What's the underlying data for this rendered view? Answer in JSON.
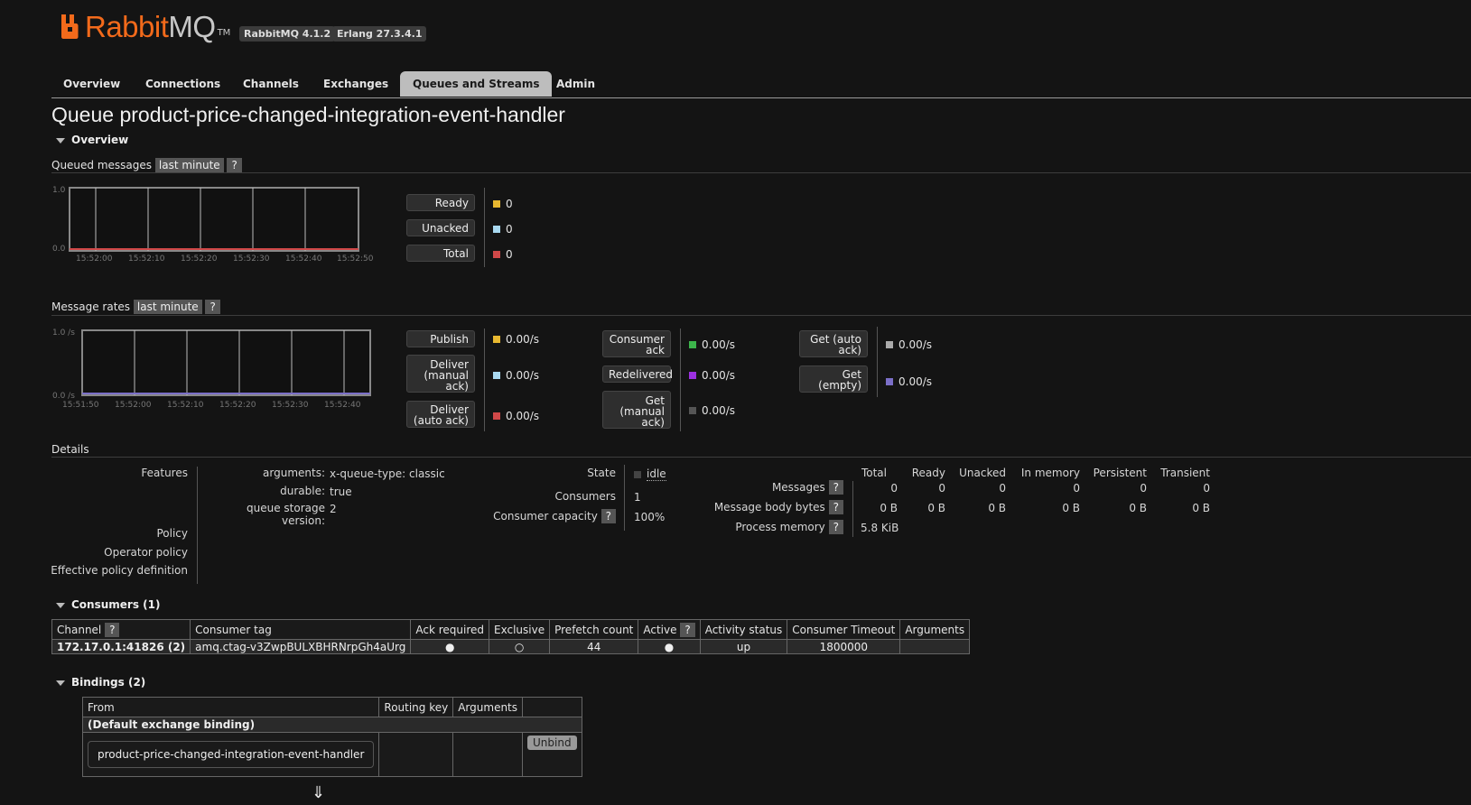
{
  "header": {
    "logo_rabbit": "Rabbit",
    "logo_mq": "MQ",
    "logo_tm": "TM",
    "rabbitmq_version": "RabbitMQ 4.1.2",
    "erlang_version": "Erlang 27.3.4.1"
  },
  "tabs": [
    "Overview",
    "Connections",
    "Channels",
    "Exchanges",
    "Queues and Streams",
    "Admin"
  ],
  "active_tab": "Queues and Streams",
  "page_title": "Queue product-price-changed-integration-event-handler",
  "overview_section": "Overview",
  "queued": {
    "title": "Queued messages",
    "range": "last minute",
    "help": "?",
    "y_top": "1.0",
    "y_bottom": "0.0",
    "x_ticks": [
      "15:52:00",
      "15:52:10",
      "15:52:20",
      "15:52:30",
      "15:52:40",
      "15:52:50"
    ],
    "legend": [
      {
        "label": "Ready",
        "value": "0",
        "color": "#e8b830"
      },
      {
        "label": "Unacked",
        "value": "0",
        "color": "#a8d8f0"
      },
      {
        "label": "Total",
        "value": "0",
        "color": "#d04848"
      }
    ]
  },
  "rates": {
    "title": "Message rates",
    "range": "last minute",
    "help": "?",
    "y_top": "1.0 /s",
    "y_bottom": "0.0 /s",
    "x_ticks": [
      "15:51:50",
      "15:52:00",
      "15:52:10",
      "15:52:20",
      "15:52:30",
      "15:52:40"
    ],
    "col1": [
      {
        "label": "Publish",
        "value": "0.00/s",
        "color": "#e8b830"
      },
      {
        "label": "Deliver (manual ack)",
        "value": "0.00/s",
        "color": "#a8d8f0"
      },
      {
        "label": "Deliver (auto ack)",
        "value": "0.00/s",
        "color": "#d04848"
      }
    ],
    "col2": [
      {
        "label": "Consumer ack",
        "value": "0.00/s",
        "color": "#3cb44b"
      },
      {
        "label": "Redelivered",
        "value": "0.00/s",
        "color": "#9b30e0"
      },
      {
        "label": "Get (manual ack)",
        "value": "0.00/s",
        "color": "#555555"
      }
    ],
    "col3": [
      {
        "label": "Get (auto ack)",
        "value": "0.00/s",
        "color": "#aaaaaa"
      },
      {
        "label": "Get (empty)",
        "value": "0.00/s",
        "color": "#7b6fc8"
      }
    ]
  },
  "details": {
    "title": "Details",
    "features_label": "Features",
    "features": [
      {
        "key": "arguments:",
        "value": "x-queue-type: classic"
      },
      {
        "key": "durable:",
        "value": "true"
      },
      {
        "key": "queue storage version:",
        "value": "2"
      }
    ],
    "policy_label": "Policy",
    "operator_policy_label": "Operator policy",
    "effective_policy_label": "Effective policy definition",
    "state_label": "State",
    "state_value": "idle",
    "consumers_label": "Consumers",
    "consumers_value": "1",
    "capacity_label": "Consumer capacity",
    "capacity_help": "?",
    "capacity_value": "100%",
    "msg_headers": [
      "Total",
      "Ready",
      "Unacked",
      "In memory",
      "Persistent",
      "Transient"
    ],
    "messages_label": "Messages",
    "messages_values": [
      "0",
      "0",
      "0",
      "0",
      "0",
      "0"
    ],
    "body_bytes_label": "Message body bytes",
    "body_bytes_values": [
      "0 B",
      "0 B",
      "0 B",
      "0 B",
      "0 B",
      "0 B"
    ],
    "process_memory_label": "Process memory",
    "process_memory_value": "5.8 KiB",
    "help": "?"
  },
  "consumers": {
    "title": "Consumers (1)",
    "headers": [
      "Channel",
      "Consumer tag",
      "Ack required",
      "Exclusive",
      "Prefetch count",
      "Active",
      "Activity status",
      "Consumer Timeout",
      "Arguments"
    ],
    "help": "?",
    "row": {
      "channel": "172.17.0.1:41826 (2)",
      "tag": "amq.ctag-v3ZwpBULXBHRNrpGh4aUrg",
      "ack_required": "●",
      "exclusive": "○",
      "prefetch": "44",
      "active": "●",
      "activity_status": "up",
      "timeout": "1800000",
      "arguments": ""
    }
  },
  "bindings": {
    "title": "Bindings (2)",
    "headers": [
      "From",
      "Routing key",
      "Arguments"
    ],
    "default_binding": "(Default exchange binding)",
    "queue_name": "product-price-changed-integration-event-handler",
    "unbind_label": "Unbind",
    "arrow": "⇓"
  }
}
